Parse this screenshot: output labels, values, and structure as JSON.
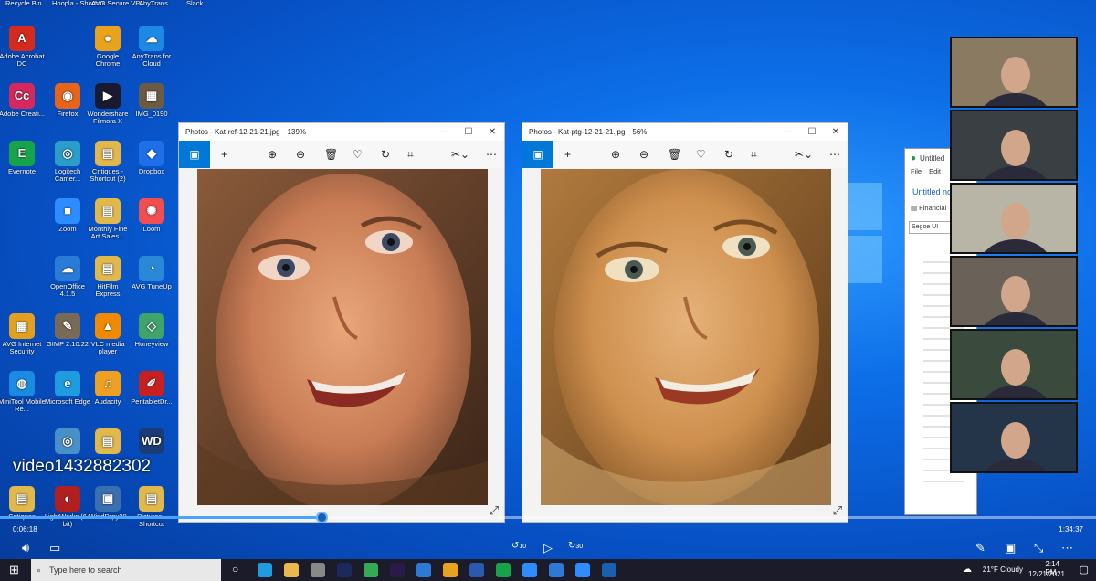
{
  "desktop": {
    "top_row": [
      "Recycle Bin",
      "Hoopla - Shortcut",
      "AVG Secure VPN",
      "AnyTrans",
      "Slack"
    ],
    "icons": [
      {
        "label": "Adobe Acrobat DC",
        "icon": "acrobat-icon",
        "color": "#d42b1e",
        "glyph": "A"
      },
      {
        "label": "Google Chrome",
        "icon": "chrome-icon",
        "color": "#e8a21b",
        "glyph": "●"
      },
      {
        "label": "AnyTrans for Cloud",
        "icon": "anytrans-cloud-icon",
        "color": "#1e88e5",
        "glyph": "☁"
      },
      {
        "label": "Adobe Creati...",
        "icon": "creative-cloud-icon",
        "color": "#d6285f",
        "glyph": "Cc"
      },
      {
        "label": "Firefox",
        "icon": "firefox-icon",
        "color": "#e8641b",
        "glyph": "◉"
      },
      {
        "label": "Wondershare Filmora X",
        "icon": "filmora-icon",
        "color": "#1a1a2e",
        "glyph": "▶"
      },
      {
        "label": "IMG_0190",
        "icon": "image-file-icon",
        "color": "#6b5a44",
        "glyph": "▦"
      },
      {
        "label": "Evernote",
        "icon": "evernote-icon",
        "color": "#17a34a",
        "glyph": "E"
      },
      {
        "label": "Logitech Camer...",
        "icon": "logitech-icon",
        "color": "#2a9ec8",
        "glyph": "◎"
      },
      {
        "label": "Critiques - Shortcut (2)",
        "icon": "folder-icon",
        "color": "#e0b84c",
        "glyph": "▤"
      },
      {
        "label": "Dropbox",
        "icon": "dropbox-icon",
        "color": "#1f6fe8",
        "glyph": "◆"
      },
      {
        "label": "Zoom",
        "icon": "zoom-icon",
        "color": "#2d8cff",
        "glyph": "■"
      },
      {
        "label": "Monthly Fine Art Sales...",
        "icon": "folder-icon",
        "color": "#e0b84c",
        "glyph": "▤"
      },
      {
        "label": "Loom",
        "icon": "loom-icon",
        "color": "#f04e50",
        "glyph": "✺"
      },
      {
        "label": "OpenOffice 4.1.5",
        "icon": "openoffice-icon",
        "color": "#2a7bd6",
        "glyph": "☁"
      },
      {
        "label": "HitFilm Express",
        "icon": "folder-icon",
        "color": "#e0b84c",
        "glyph": "▤"
      },
      {
        "label": "AVG TuneUp",
        "icon": "avg-tuneup-icon",
        "color": "#2a88d8",
        "glyph": "◔"
      },
      {
        "label": "AVG Internet Security",
        "icon": "avg-icon",
        "color": "#e2a020",
        "glyph": "▦"
      },
      {
        "label": "GIMP 2.10.22",
        "icon": "gimp-icon",
        "color": "#7a6a55",
        "glyph": "✎"
      },
      {
        "label": "VLC media player",
        "icon": "vlc-icon",
        "color": "#f08a00",
        "glyph": "▲"
      },
      {
        "label": "Honeyview",
        "icon": "honeyview-icon",
        "color": "#3fa36a",
        "glyph": "◇"
      },
      {
        "label": "MiniTool Mobile Re...",
        "icon": "minitool-icon",
        "color": "#1a8be0",
        "glyph": "◍"
      },
      {
        "label": "Microsoft Edge",
        "icon": "edge-icon",
        "color": "#1f9be0",
        "glyph": "e"
      },
      {
        "label": "Audacity",
        "icon": "audacity-icon",
        "color": "#f0a020",
        "glyph": "♫"
      },
      {
        "label": "PentabletDr...",
        "icon": "pentablet-icon",
        "color": "#c82020",
        "glyph": "✐"
      },
      {
        "label": "Critiques",
        "icon": "folder-icon",
        "color": "#e0b84c",
        "glyph": "▤"
      },
      {
        "label": "LightWorks (64 bit)",
        "icon": "lightworks-icon",
        "color": "#b02020",
        "glyph": "◐"
      },
      {
        "label": "WindDrpy20",
        "icon": "app-icon",
        "color": "#3a6fb0",
        "glyph": "▣"
      },
      {
        "label": "Pictures - Shortcut",
        "icon": "folder-icon",
        "color": "#e0b84c",
        "glyph": "▤"
      },
      {
        "label": "",
        "icon": "webcam-icon",
        "color": "#4a90c8",
        "glyph": "◎"
      },
      {
        "label": "",
        "icon": "folder-icon",
        "color": "#e0b84c",
        "glyph": "▤"
      },
      {
        "label": "",
        "icon": "wd-icon",
        "color": "#1a3a78",
        "glyph": "WD"
      }
    ]
  },
  "photo_windows": [
    {
      "title": "Photos - Kat-ref-12-21-21.jpg",
      "zoom": "139%"
    },
    {
      "title": "Photos - Kat-ptg-12-21-21.jpg",
      "zoom": "56%"
    }
  ],
  "photo_toolbar": {
    "icons": [
      "image-view-icon",
      "add-icon",
      "zoom-in-icon",
      "zoom-out-icon",
      "delete-icon",
      "favorite-icon",
      "rotate-icon",
      "crop-icon",
      "edit-icon",
      "more-icon"
    ]
  },
  "side_window": {
    "title": "Untitled",
    "menu": [
      "File",
      "Edit"
    ],
    "doc_title": "Untitled no",
    "tab": "Financial",
    "font": "Segoe UI"
  },
  "video_tiles": [
    {
      "name": "participant-1",
      "bg": "#8a7a62"
    },
    {
      "name": "participant-2",
      "bg": "#3a3f44"
    },
    {
      "name": "participant-3",
      "bg": "#b8b4a6"
    },
    {
      "name": "participant-4",
      "bg": "#6a6258"
    },
    {
      "name": "participant-5",
      "bg": "#3a4a3c"
    },
    {
      "name": "participant-6",
      "bg": "#24354a"
    }
  ],
  "player": {
    "video_name": "video1432882302",
    "elapsed": "0:06:18",
    "duration": "1:34:37",
    "progress": 0.294,
    "skip_back": "10",
    "skip_forward": "30"
  },
  "taskbar": {
    "search_placeholder": "Type here to search",
    "weather": "21°F  Cloudy",
    "time": "2:14 PM",
    "date": "12/21/2021"
  },
  "colors": {
    "accent": "#0078d7",
    "seek": "#4aa3ff"
  }
}
